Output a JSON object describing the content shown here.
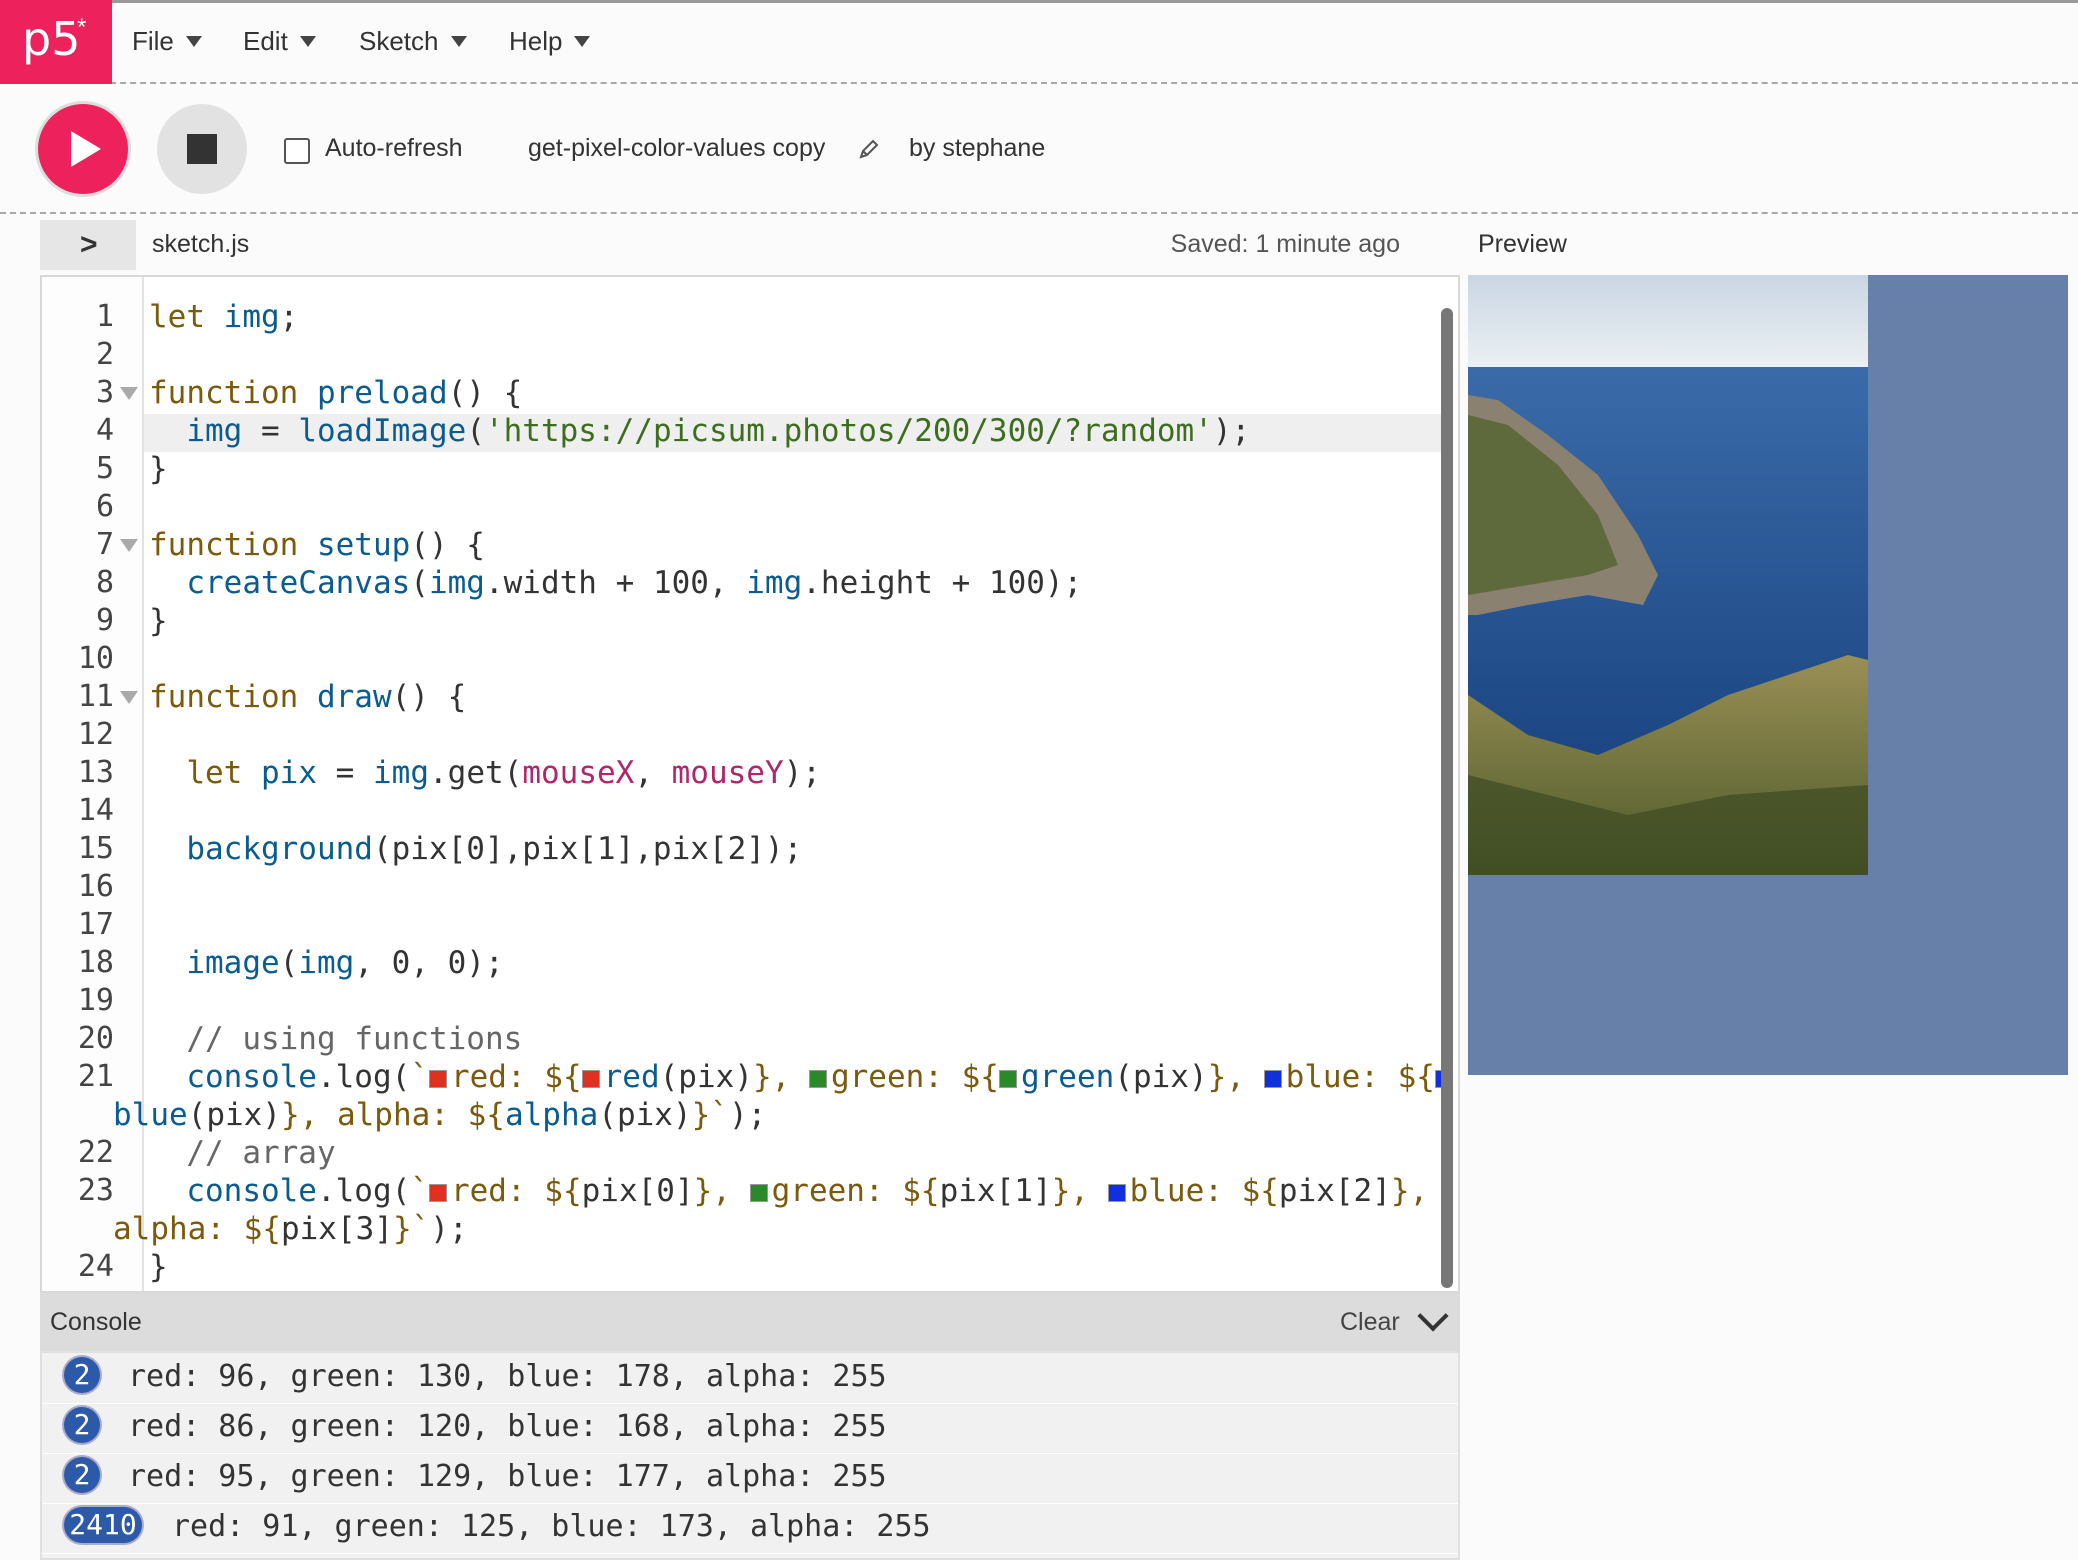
{
  "app": {
    "logo_text": "p5",
    "logo_star": "*"
  },
  "menu": [
    {
      "label": "File"
    },
    {
      "label": "Edit"
    },
    {
      "label": "Sketch"
    },
    {
      "label": "Help"
    }
  ],
  "toolbar": {
    "auto_refresh_label": "Auto-refresh",
    "sketch_name": "get-pixel-color-values copy",
    "author": "by stephane"
  },
  "editor": {
    "file_name": "sketch.js",
    "saved_status": "Saved: 1 minute ago",
    "preview_label": "Preview",
    "line_numbers": [
      "1",
      "2",
      "3",
      "4",
      "5",
      "6",
      "7",
      "8",
      "9",
      "10",
      "11",
      "12",
      "13",
      "14",
      "15",
      "16",
      "17",
      "18",
      "19",
      "20",
      "21",
      "22",
      "23",
      "24"
    ]
  },
  "console": {
    "title": "Console",
    "clear_label": "Clear",
    "entries": [
      {
        "count": "2",
        "message": "red: 96, green: 130, blue: 178, alpha: 255"
      },
      {
        "count": "2",
        "message": "red: 86, green: 120, blue: 168, alpha: 255"
      },
      {
        "count": "2",
        "message": "red: 95, green: 129, blue: 177, alpha: 255"
      },
      {
        "count": "2410",
        "message": "red: 91, green: 125, blue: 173, alpha: 255"
      }
    ]
  },
  "colors": {
    "accent": "#ed225d",
    "canvas_background": "#6680a9",
    "console_badge": "#2d5aa8"
  },
  "icons": [
    "play-icon",
    "stop-icon",
    "pencil-icon",
    "chevron-right-icon",
    "chevron-down-icon",
    "fold-arrow-icon"
  ]
}
